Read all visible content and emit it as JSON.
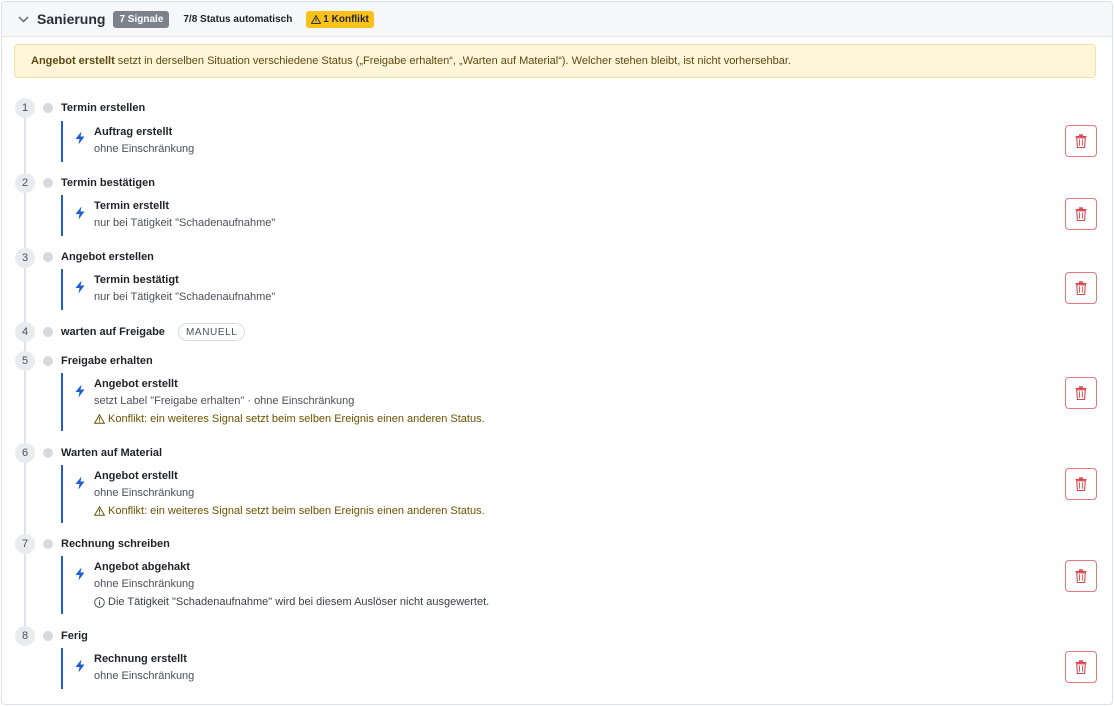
{
  "header": {
    "title": "Sanierung",
    "signals_badge": "7 Signale",
    "status_auto": "7/8 Status automatisch",
    "conflict_badge": "1 Konflikt"
  },
  "alert": {
    "strong": "Angebot erstellt",
    "text": " setzt in derselben Situation verschiedene Status („Freigabe erhalten“, „Warten auf Material“). Welcher stehen bleibt, ist nicht vorhersehbar."
  },
  "steps": [
    {
      "num": "1",
      "title": "Termin erstellen",
      "trigger": {
        "title": "Auftrag erstellt",
        "sub": "ohne Einschränkung"
      }
    },
    {
      "num": "2",
      "title": "Termin bestätigen",
      "trigger": {
        "title": "Termin erstellt",
        "sub": "nur bei Tätigkeit \"Schadenaufnahme\""
      }
    },
    {
      "num": "3",
      "title": "Angebot erstellen",
      "trigger": {
        "title": "Termin bestätigt",
        "sub": "nur bei Tätigkeit \"Schadenaufnahme\""
      }
    },
    {
      "num": "4",
      "title": "warten auf Freigabe",
      "tag": "MANUELL"
    },
    {
      "num": "5",
      "title": "Freigabe erhalten",
      "trigger": {
        "title": "Angebot erstellt",
        "sub": "setzt Label \"Freigabe erhalten\" · ohne Einschränkung",
        "note": "Konflikt: ein weiteres Signal setzt beim selben Ereignis einen anderen Status."
      }
    },
    {
      "num": "6",
      "title": "Warten auf Material",
      "trigger": {
        "title": "Angebot erstellt",
        "sub": "ohne Einschränkung",
        "note": "Konflikt: ein weiteres Signal setzt beim selben Ereignis einen anderen Status."
      }
    },
    {
      "num": "7",
      "title": "Rechnung schreiben",
      "trigger": {
        "title": "Angebot abgehakt",
        "sub": "ohne Einschränkung",
        "note": "Die Tätigkeit \"Schadenaufnahme\" wird bei diesem Auslöser nicht ausgewertet."
      }
    },
    {
      "num": "8",
      "title": "Ferig",
      "trigger": {
        "title": "Rechnung erstellt",
        "sub": "ohne Einschränkung"
      }
    }
  ],
  "colors": {
    "accent_blue": "#1f5fd1",
    "warning_yellow": "#f9c21a",
    "delete_red": "#d9464f"
  },
  "icons": {
    "collapse": "chevron-down-icon",
    "trigger": "lightning-bolt-icon",
    "delete": "trash-icon",
    "warning": "warning-triangle-icon",
    "info": "info-circle-icon"
  }
}
